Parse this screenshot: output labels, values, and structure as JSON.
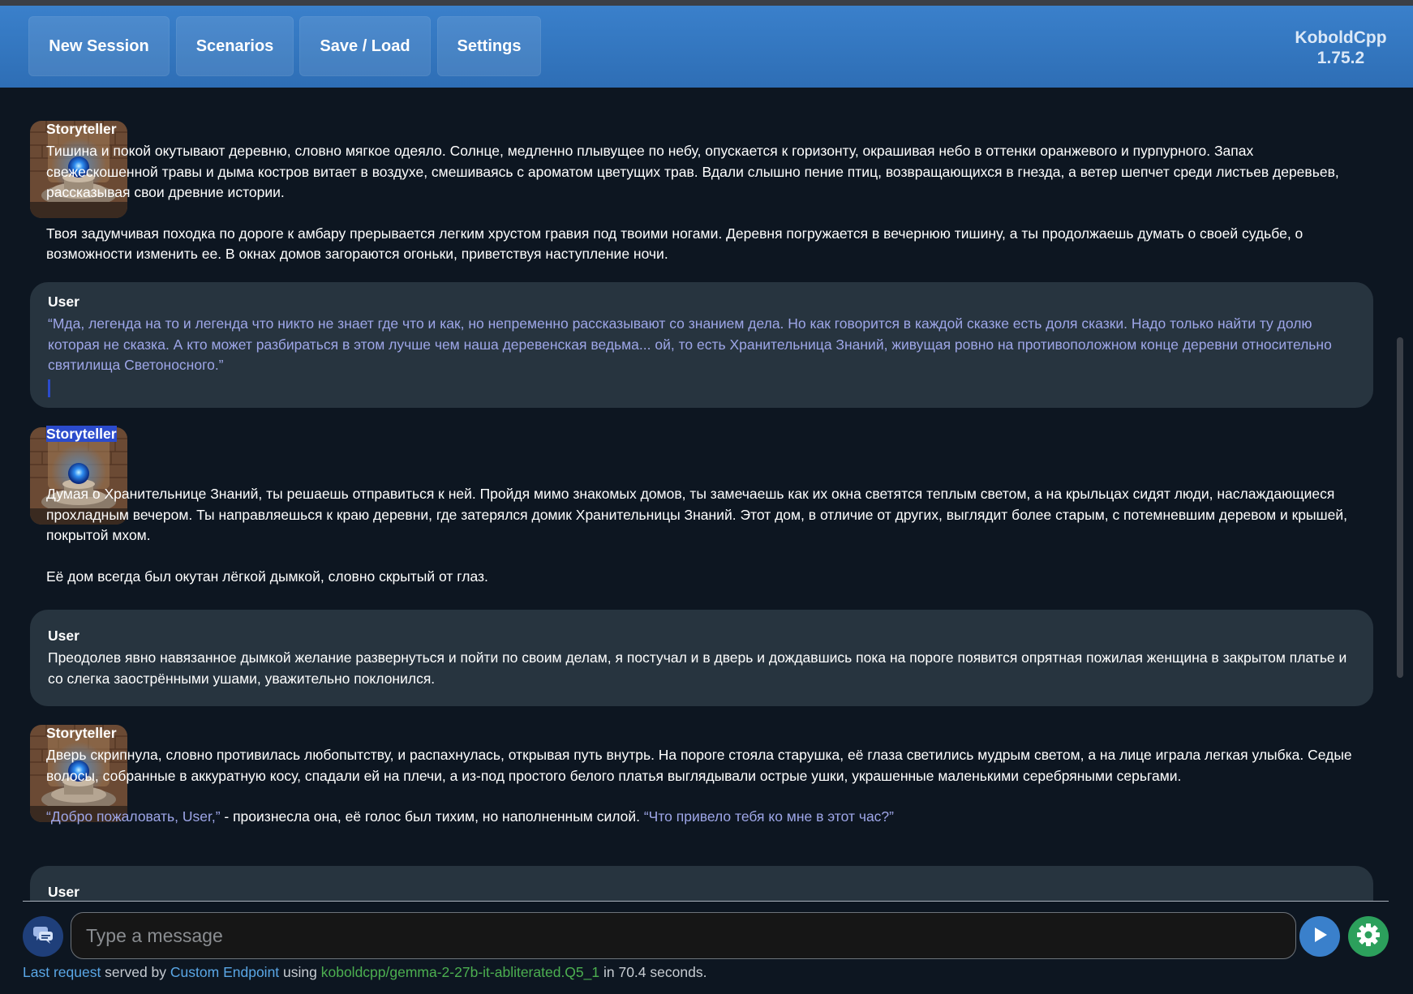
{
  "topbar": {
    "buttons": [
      "New Session",
      "Scenarios",
      "Save / Load",
      "Settings"
    ],
    "brand_name": "KoboldCpp",
    "brand_version": "1.75.2"
  },
  "messages": [
    {
      "author": "Storyteller",
      "paragraphs": [
        "Тишина и покой окутывают деревню, словно мягкое одеяло. Солнце, медленно плывущее по небу, опускается к горизонту, окрашивая небо в оттенки оранжевого и пурпурного. Запах свежескошенной травы и дыма костров витает в воздухе, смешиваясь с ароматом цветущих трав. Вдали слышно пение птиц, возвращающихся в гнезда, а ветер шепчет среди листьев деревьев, рассказывая свои древние истории.",
        "Твоя задумчивая походка по дороге к амбару прерывается легким хрустом гравия под твоими ногами. Деревня погружается в вечернюю тишину, а ты продолжаешь думать о своей судьбе, о возможности изменить ее.  В окнах домов загораются огоньки, приветствуя наступление ночи."
      ]
    },
    {
      "author": "User",
      "quote": "“Мда, легенда на то и легенда что никто не знает где что и как, но непременно рассказывают со знанием дела. Но как говорится в каждой сказке есть доля сказки. Надо только найти ту долю которая не сказка. А кто может разбираться в этом лучше чем наша деревенская ведьма... ой, то есть Хранительница Знаний, живущая ровно на противоположном конце деревни относительно святилища Светоносного.”"
    },
    {
      "author": "Storyteller",
      "paragraphs": [
        "Думая о Хранительнице Знаний, ты решаешь отправиться к ней. Пройдя мимо знакомых домов, ты замечаешь как их окна светятся теплым светом, а на крыльцах сидят люди, наслаждающиеся прохладным вечером.  Ты направляешься к краю деревни, где затерялся домик Хранительницы Знаний. Этот дом, в отличие от других, выглядит более старым, с потемневшим деревом и крышей, покрытой мхом.",
        "Её дом всегда был окутан лёгкой дымкой, словно скрытый от глаз."
      ]
    },
    {
      "author": "User",
      "text": "Преодолев явно навязанное дымкой желание развернуться и пойти по своим делам, я постучал и в дверь и дождавшись пока на пороге появится опрятная пожилая женщина в закрытом платье и со слегка заострёнными ушами, уважительно поклонился."
    },
    {
      "author": "Storyteller",
      "paragraph": "Дверь скрипнула, словно противилась любопытству, и распахнулась, открывая путь внутрь. На пороге стояла старушка, её глаза светились мудрым светом, а на лице играла легкая улыбка. Седые волосы, собранные в аккуратную косу, спадали ей на плечи, а из-под простого белого платья выглядывали острые ушки, украшенные маленькими серебряными серьгами.",
      "quote1": "“Добро пожаловать, User,”",
      "middle": " - произнесла она, её голос был тихим, но наполненным силой. ",
      "quote2": "“Что привело тебя ко мне в этот час?”"
    },
    {
      "author": "User"
    }
  ],
  "input": {
    "placeholder": "Type a message"
  },
  "status": {
    "last_request": "Last request",
    "served_by": " served by ",
    "endpoint": "Custom Endpoint",
    "using": " using ",
    "model": "koboldcpp/gemma-2-27b-it-abliterated.Q5_1",
    "tail": " in 70.4 seconds."
  },
  "icons": {
    "left_button": "chat-bubbles-icon",
    "send_button": "play-icon",
    "settings_button": "gear-icon"
  },
  "colors": {
    "topbar": "#3579c2",
    "story_bubble": "#15142f",
    "user_bubble": "#27343f",
    "quote_text": "#9ea6e8",
    "send_button": "#3a80cb",
    "settings_button": "#2ca05c"
  }
}
